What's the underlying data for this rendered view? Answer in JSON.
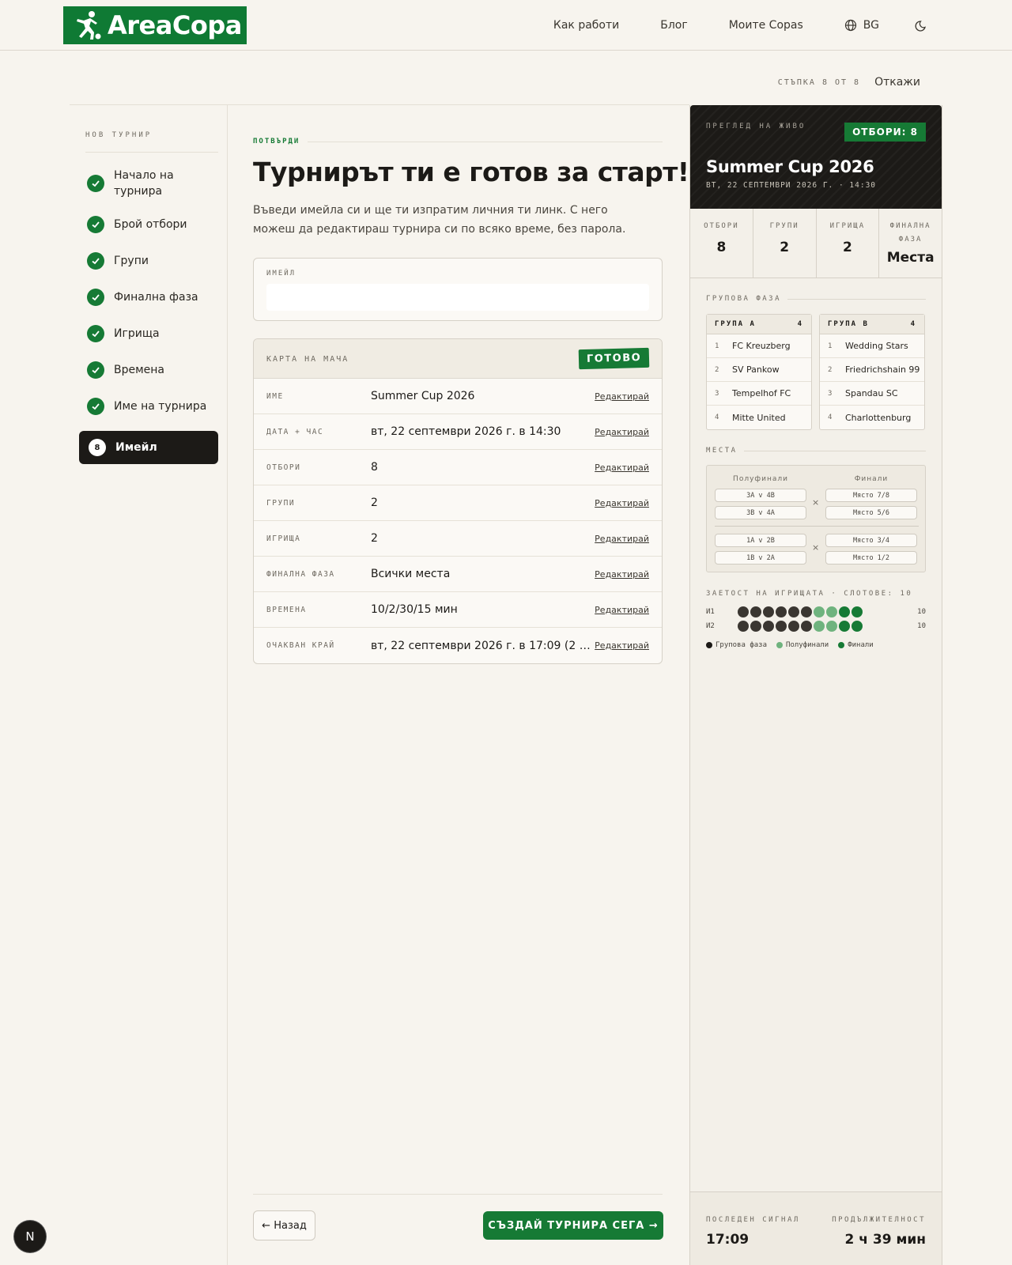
{
  "header": {
    "logo_text": "AreaCopa",
    "nav": [
      "Как работи",
      "Блог",
      "Моите Copas"
    ],
    "lang": "BG"
  },
  "progress": {
    "step_text": "СТЪПКА 8 ОТ 8",
    "current_step": 8,
    "total_steps": 8,
    "cancel": "Откажи"
  },
  "sidebar": {
    "title": "НОВ ТУРНИР",
    "steps": [
      {
        "label": "Начало на турнира",
        "done": true
      },
      {
        "label": "Брой отбори",
        "done": true
      },
      {
        "label": "Групи",
        "done": true
      },
      {
        "label": "Финална фаза",
        "done": true
      },
      {
        "label": "Игрища",
        "done": true
      },
      {
        "label": "Времена",
        "done": true
      },
      {
        "label": "Име на турнира",
        "done": true
      },
      {
        "label": "Имейл",
        "done": false,
        "number": "8"
      }
    ]
  },
  "main": {
    "eyebrow": "ПОТВЪРДИ",
    "title": "Турнирът ти е готов за старт!",
    "lead": "Въведи имейла си и ще ти изпратим личния ти линк. С него можеш да редактираш турнира си по всяко време, без парола.",
    "email_label": "ИМЕЙЛ",
    "email_value": "",
    "card_title": "КАРТА НА МАЧА",
    "card_stamp": "ГОТОВО",
    "edit_label": "Редактирай",
    "rows": [
      {
        "key": "ИМЕ",
        "value": "Summer Cup 2026"
      },
      {
        "key": "ДАТА + ЧАС",
        "value": "вт, 22 септември 2026 г. в 14:30"
      },
      {
        "key": "ОТБОРИ",
        "value": "8"
      },
      {
        "key": "ГРУПИ",
        "value": "2"
      },
      {
        "key": "ИГРИЩА",
        "value": "2"
      },
      {
        "key": "ФИНАЛНА ФАЗА",
        "value": "Всички места"
      },
      {
        "key": "ВРЕМЕНА",
        "value": "10/2/30/15 мин"
      },
      {
        "key": "ОЧАКВАН КРАЙ",
        "value": "вт, 22 септември 2026 г. в 17:09 (2 ч 39 м…"
      }
    ],
    "back_button": "← Назад",
    "create_button": "СЪЗДАЙ ТУРНИРА СЕГА →"
  },
  "preview": {
    "live_label": "ПРЕГЛЕД НА ЖИВО",
    "teams_stamp": "ОТБОРИ: 8",
    "title": "Summer Cup 2026",
    "date": "ВТ, 22 СЕПТЕМВРИ 2026 Г. · 14:30",
    "stats": [
      {
        "label": "ОТБОРИ",
        "value": "8"
      },
      {
        "label": "ГРУПИ",
        "value": "2"
      },
      {
        "label": "ИГРИЩА",
        "value": "2"
      },
      {
        "label": "ФИНАЛНА ФАЗА",
        "value": "Места"
      }
    ],
    "group_phase_label": "ГРУПОВА ФАЗА",
    "groups": [
      {
        "name": "ГРУПА А",
        "count": "4",
        "teams": [
          "FC Kreuzberg",
          "SV Pankow",
          "Tempelhof FC",
          "Mitte United"
        ]
      },
      {
        "name": "ГРУПА В",
        "count": "4",
        "teams": [
          "Wedding Stars",
          "Friedrichshain 99",
          "Spandau SC",
          "Charlottenburg"
        ]
      }
    ],
    "places_label": "МЕСТА",
    "bracket": {
      "semis_label": "Полуфинали",
      "finals_label": "Финали",
      "semis": [
        "3A v 4B",
        "3B v 4A",
        "1A v 2B",
        "1B v 2A"
      ],
      "finals": [
        "Място 7/8",
        "Място 5/6",
        "Място 3/4",
        "Място 1/2"
      ],
      "x_mark": "×"
    },
    "occupancy_label": "ЗАЕТОСТ НА ИГРИЩАТА · СЛОТОВЕ: 10",
    "occupancy": [
      {
        "label": "И1",
        "count": "10",
        "slots": [
          "g",
          "g",
          "g",
          "g",
          "g",
          "g",
          "s",
          "s",
          "f",
          "f"
        ]
      },
      {
        "label": "И2",
        "count": "10",
        "slots": [
          "g",
          "g",
          "g",
          "g",
          "g",
          "g",
          "s",
          "s",
          "f",
          "f"
        ]
      }
    ],
    "legend": [
      {
        "label": "Групова фаза",
        "color": "#1c1a17"
      },
      {
        "label": "Полуфинали",
        "color": "#6fb37e"
      },
      {
        "label": "Финали",
        "color": "#167a35"
      }
    ],
    "footer": {
      "last_signal_label": "ПОСЛЕДЕН СИГНАЛ",
      "last_signal_value": "17:09",
      "duration_label": "ПРОДЪЛЖИТЕЛНОСТ",
      "duration_value": "2 ч 39 мин"
    }
  },
  "badge": "N",
  "colors": {
    "brand": "#167a35",
    "dark": "#1c1a17",
    "group_slot": "#3a3631",
    "semi_slot": "#6fb37e",
    "final_slot": "#167a35"
  }
}
